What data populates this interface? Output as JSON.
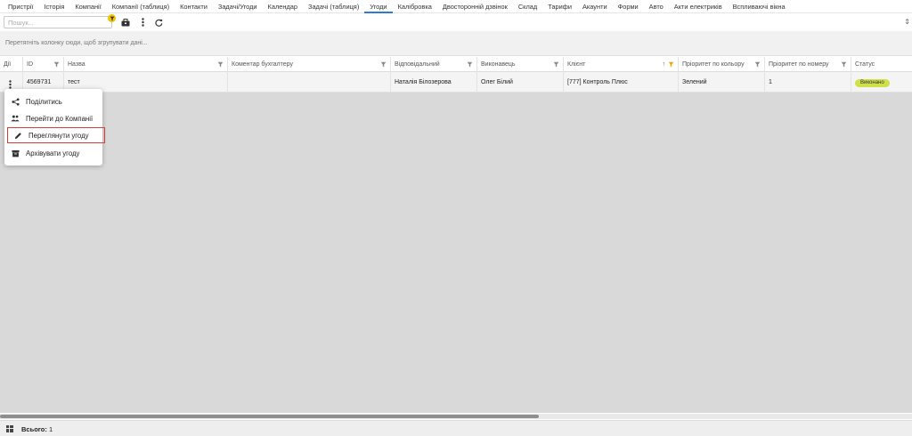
{
  "nav": {
    "tabs": [
      "Пристрії",
      "Історія",
      "Компанії",
      "Компанії (таблиця)",
      "Контакти",
      "Задачі/Угоди",
      "Календар",
      "Задачі (таблиця)",
      "Угоди",
      "Калібровка",
      "Двосторонній дзвінок",
      "Склад",
      "Тарифи",
      "Акаунти",
      "Форми",
      "Авто",
      "Акти електриків",
      "Вспливаючі вікна"
    ],
    "active_index": 8
  },
  "toolbar": {
    "search_placeholder": "Пошук...",
    "icons": [
      "filter-active-icon",
      "toolbox-icon",
      "more-vertical-icon",
      "refresh-icon"
    ],
    "accent": "#f2c200"
  },
  "group_hint": "Перетягніть колонку сюди, щоб згрупувати дані...",
  "grid": {
    "headers": [
      "Дії",
      "ID",
      "Назва",
      "Коментар бухгалтеру",
      "Відповідальний",
      "Виконавець",
      "Клієнт",
      "Пріоритет по кольору",
      "Пріоритет по номеру",
      "Статус"
    ],
    "row": {
      "id": "4569731",
      "name": "тест",
      "comment": "",
      "responsible": "Наталія Білозерова",
      "executor": "Олег Білий",
      "client": "[777] Контроль Плюс",
      "priority_color": "Зелений",
      "priority_number": "1",
      "status": "Виконано"
    },
    "status_color": "#cfe04a"
  },
  "menu": {
    "items": [
      {
        "label": "Поділитись",
        "icon": "share-icon"
      },
      {
        "label": "Перейти до Компанії",
        "icon": "people-icon"
      },
      {
        "label": "Переглянути угоду",
        "icon": "pencil-icon"
      },
      {
        "label": "Архівувати угоду",
        "icon": "archive-icon"
      }
    ],
    "highlighted_index": 2,
    "highlight_color": "#d93a3a"
  },
  "footer": {
    "total_label": "Всього:",
    "total_value": "1"
  }
}
